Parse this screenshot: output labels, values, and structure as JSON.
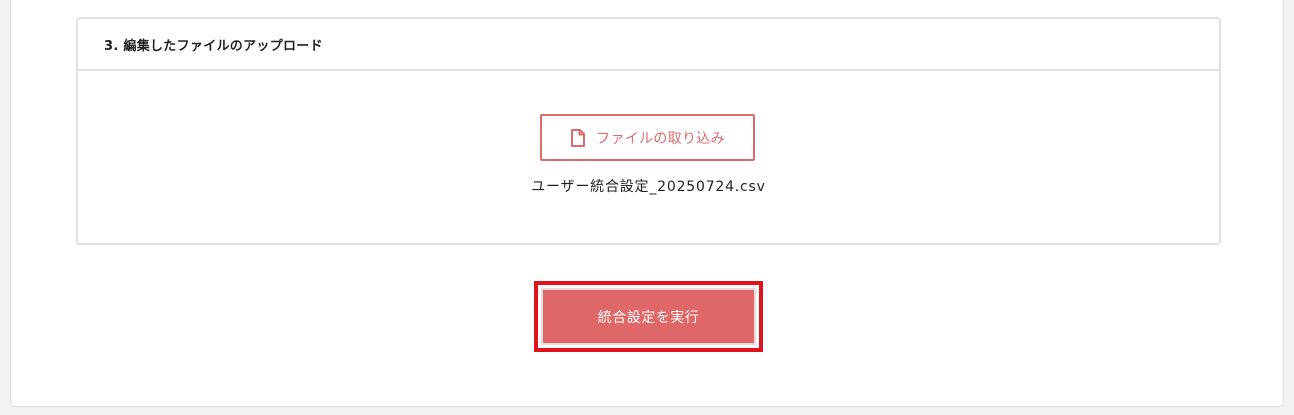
{
  "section": {
    "title": "3. 編集したファイルのアップロード"
  },
  "upload": {
    "button_label": "ファイルの取り込み",
    "icon": "file-icon",
    "selected_file": "ユーザー統合設定_20250724.csv"
  },
  "actions": {
    "execute_label": "統合設定を実行"
  },
  "colors": {
    "accent": "#df6767",
    "highlight": "#e0131d"
  }
}
